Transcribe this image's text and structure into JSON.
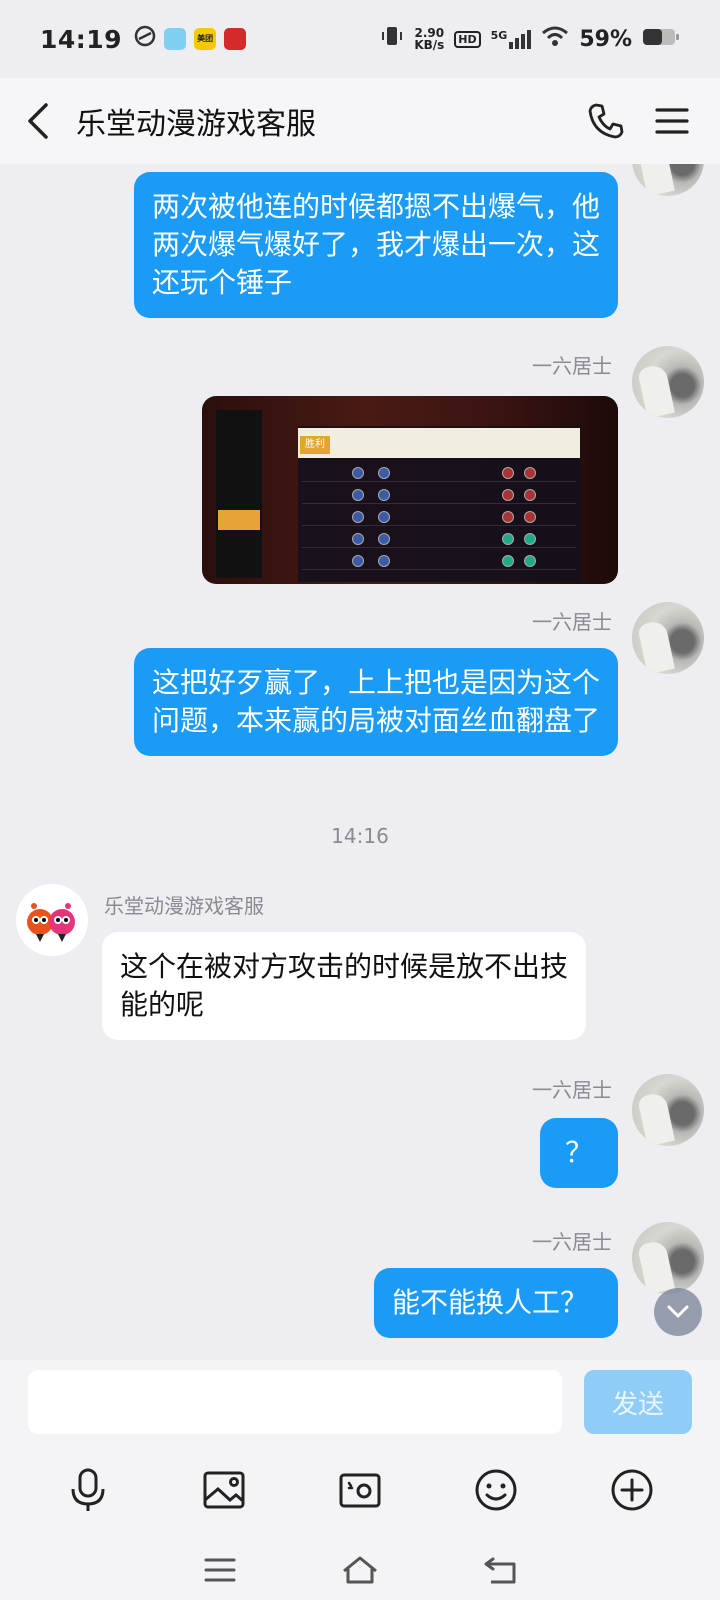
{
  "status_bar": {
    "time": "14:19",
    "speed_value": "2.90",
    "speed_unit": "KB/s",
    "hd": "HD",
    "network": "5G",
    "battery": "59%",
    "app_meituan": "美团"
  },
  "header": {
    "title": "乐堂动漫游戏客服"
  },
  "messages": {
    "m1": "两次被他连的时候都摁不出爆气，他两次爆气爆好了，我才爆出一次，这还玩个锤子",
    "m2_nick": "一六居士",
    "m2_image_win": "胜利",
    "m3_nick": "一六居士",
    "m3": "这把好歹赢了，上上把也是因为这个问题，本来赢的局被对面丝血翻盘了",
    "time_sep": "14:16",
    "m4_nick": "乐堂动漫游戏客服",
    "m4": "这个在被对方攻击的时候是放不出技能的呢",
    "m5_nick": "一六居士",
    "m5": "？",
    "m6_nick": "一六居士",
    "m6": "能不能换人工？"
  },
  "input": {
    "value": "",
    "placeholder": "",
    "send_label": "发送"
  },
  "colors": {
    "my_bubble": "#1a9bf5",
    "other_bubble": "#ffffff",
    "send_disabled": "#8fcdf6",
    "background": "#ededf2"
  },
  "icons": {
    "toolbar": [
      "microphone-icon",
      "image-icon",
      "camera-icon",
      "emoji-icon",
      "plus-icon"
    ],
    "navbar": [
      "menu-icon",
      "home-icon",
      "back-icon"
    ]
  }
}
